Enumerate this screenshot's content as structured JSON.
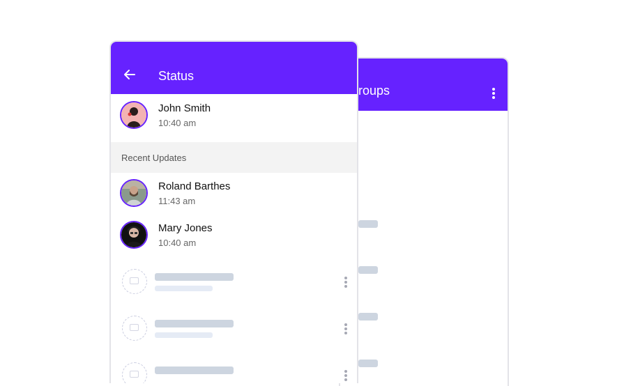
{
  "back_screen": {
    "title": "Groups"
  },
  "status_screen": {
    "title": "Status",
    "my_status": {
      "name": "John Smith",
      "time": "10:40 am"
    },
    "section_header": "Recent Updates",
    "updates": [
      {
        "name": "Roland Barthes",
        "time": "11:43 am"
      },
      {
        "name": "Mary Jones",
        "time": "10:40 am"
      }
    ]
  },
  "colors": {
    "accent": "#6622ff",
    "skeleton": "#cdd5e0",
    "skeleton_light": "#e5ebf5"
  }
}
